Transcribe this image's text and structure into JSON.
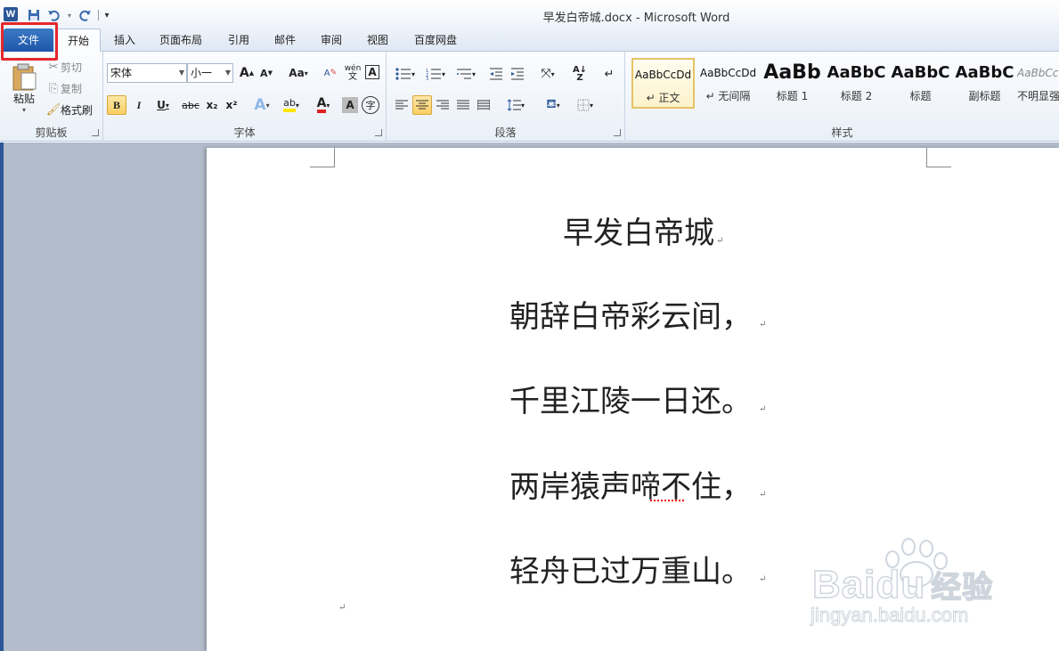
{
  "window": {
    "title": "早发白帝城.docx  -  Microsoft Word",
    "app_icon_letter": "W"
  },
  "tabs": [
    "文件",
    "开始",
    "插入",
    "页面布局",
    "引用",
    "邮件",
    "审阅",
    "视图",
    "百度网盘"
  ],
  "clipboard": {
    "paste": "粘贴",
    "cut": "剪切",
    "copy": "复制",
    "format_painter": "格式刷",
    "label": "剪贴板"
  },
  "font": {
    "name": "宋体",
    "size": "小一",
    "label": "字体",
    "grow": "A",
    "shrink": "A",
    "case": "Aa",
    "bold": "B",
    "italic": "I",
    "underline": "U",
    "strike": "abc",
    "sub": "x₂",
    "sup": "x²",
    "clear": "A",
    "phonetic": "wén",
    "border_char": "A",
    "color_a": "A",
    "shade_a": "A",
    "enclose": "字"
  },
  "paragraph": {
    "label": "段落"
  },
  "styles": {
    "label": "样式",
    "tiles": [
      {
        "sample": "AaBbCcDd",
        "name": "↵ 正文"
      },
      {
        "sample": "AaBbCcDd",
        "name": "↵ 无间隔"
      },
      {
        "sample": "AaBb",
        "name": "标题 1"
      },
      {
        "sample": "AaBbC",
        "name": "标题 2"
      },
      {
        "sample": "AaBbC",
        "name": "标题"
      },
      {
        "sample": "AaBbC",
        "name": "副标题"
      },
      {
        "sample": "AaBbCc",
        "name": "不明显强"
      }
    ]
  },
  "document": {
    "title": "早发白帝城",
    "lines": [
      "朝辞白帝彩云间，",
      "千里江陵一日还。",
      "两岸猿声啼不住，",
      "轻舟已过万重山。"
    ],
    "para_mark": "↵"
  },
  "watermark": {
    "brand": "Baidu",
    "brand_cn": "经验",
    "url": "jingyan.baidu.com"
  },
  "colors": {
    "file_tab": "#2b5797",
    "highlight": "#e3282d",
    "workspace": "#b3bccb"
  }
}
